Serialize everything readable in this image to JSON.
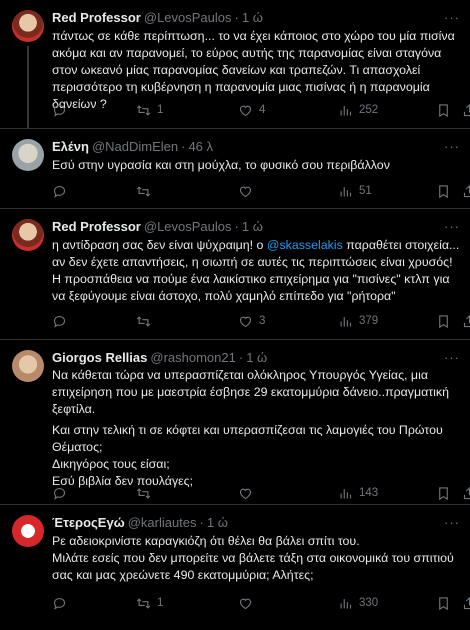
{
  "tweets": [
    {
      "name": "Red Professor",
      "handle": "@LevosPaulos",
      "sep": "·",
      "time": "1 ώ",
      "body": "πάντως σε κάθε περίπτωση... το να έχει κάποιος στο χώρο του μία πισίνα ακόμα και αν παρανομεί, το εύρος αυτής της παρανομίας είναι σταγόνα στον ωκεανό μίας παρανομίας δανείων και τραπεζών. Τι απασχολεί περισσότερο τη κυβέρνηση η παρανομία μιας πισίνας ή η παρανομία δανείων ?",
      "replies": "",
      "retweets": "1",
      "likes": "4",
      "views": "252"
    },
    {
      "name": "Ελένη",
      "handle": "@NadDimElen",
      "sep": "·",
      "time": "46 λ",
      "body": "Εσύ στην υγρασία και στη μούχλα, το φυσικό σου περιβάλλον",
      "replies": "",
      "retweets": "",
      "likes": "",
      "views": "51"
    },
    {
      "name": "Red Professor",
      "handle": "@LevosPaulos",
      "sep": "·",
      "time": "1 ώ",
      "body_pre": "η αντίδραση σας δεν είναι ψύχραιμη! ο ",
      "body_link": "@skasselakis",
      "body_post": " παραθέτει στοιχεία... αν δεν έχετε απαντήσεις, η σιωπή σε αυτές τις περιπτώσεις είναι χρυσός! Η προσπάθεια να πούμε ένα λαικίστικο επιχείρημα για \"πισίνες\" κτλπ για να ξεφύγουμε είναι άστοχο, πολύ χαμηλό επίπεδο για \"ρήτορα\"",
      "replies": "",
      "retweets": "",
      "likes": "3",
      "views": "379"
    },
    {
      "name": "Giorgos Rellias",
      "handle": "@rashomon21",
      "sep": "·",
      "time": "1 ώ",
      "lines": [
        "Να κάθεται τώρα να υπερασπίζεται ολόκληρος Υπουργός Υγείας, μια επιχείρηση που με μαεστρία έσβησε 29 εκατομμύρια δάνειο..πραγματική ξεφτίλα.",
        "Και στην τελική τι σε κόφτει και υπερασπίζεσαι τις λαμογιές του Πρώτου Θέματος;",
        "Δικηγόρος τους είσαι;",
        "Εσύ βιβλία δεν πουλάγες;"
      ],
      "replies": "",
      "retweets": "",
      "likes": "",
      "views": "143"
    },
    {
      "name": "ΈτεροςΕγώ",
      "handle": "@karliautes",
      "sep": "·",
      "time": "1 ώ",
      "lines": [
        "Ρε αδειοκρινίστε καραγκιόζη ότι θέλει θα βάλει σπίτι του.",
        "Μιλάτε εσείς που δεν μπορείτε να βάλετε τάξη στα οικονομικά του σπιτιού σας και μας χρεώνετε 490 εκατομμύρια; Αλήτες;"
      ],
      "replies": "",
      "retweets": "1",
      "likes": "",
      "views": "330"
    }
  ],
  "colors": {
    "background": "#000000",
    "text": "#e7e9ea",
    "muted": "#71767b",
    "link": "#1d9bf0",
    "divider": "#2f3336"
  },
  "icons": [
    "reply-icon",
    "retweet-icon",
    "like-icon",
    "views-icon",
    "bookmark-icon",
    "share-icon",
    "more-icon"
  ]
}
